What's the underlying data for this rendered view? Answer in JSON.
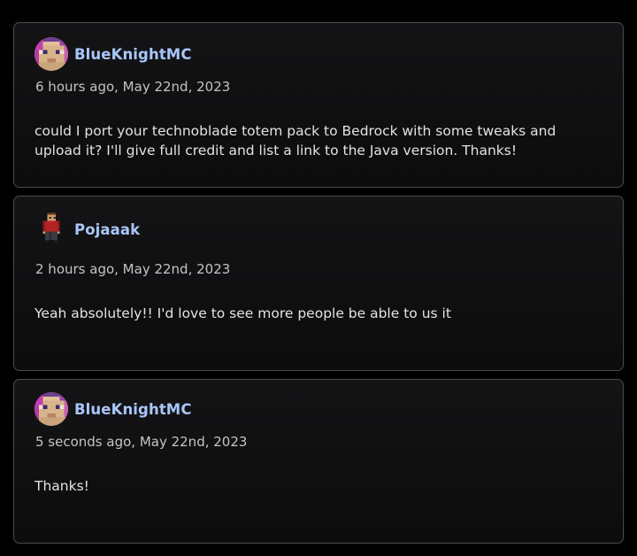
{
  "comments": [
    {
      "username": "BlueKnightMC",
      "avatar_icon": "blueknight-avatar-icon",
      "timestamp": "6 hours ago, May 22nd, 2023",
      "text": "could I port your technoblade totem pack to Bedrock with some tweaks and upload it? I'll give full credit and list a link to the Java version. Thanks!"
    },
    {
      "username": "Pojaaak",
      "avatar_icon": "pojaaak-skin-icon",
      "timestamp": "2 hours ago, May 22nd, 2023",
      "text": "Yeah absolutely!! I'd love to see more people be able to us it"
    },
    {
      "username": "BlueKnightMC",
      "avatar_icon": "blueknight-avatar-icon",
      "timestamp": "5 seconds ago, May 22nd, 2023",
      "text": "Thanks!"
    }
  ],
  "colors": {
    "background": "#000000",
    "card_border": "#4b4b4f",
    "username": "#a8c7fa",
    "timestamp": "#c4c4c7",
    "body_text": "#e3e3e6"
  }
}
